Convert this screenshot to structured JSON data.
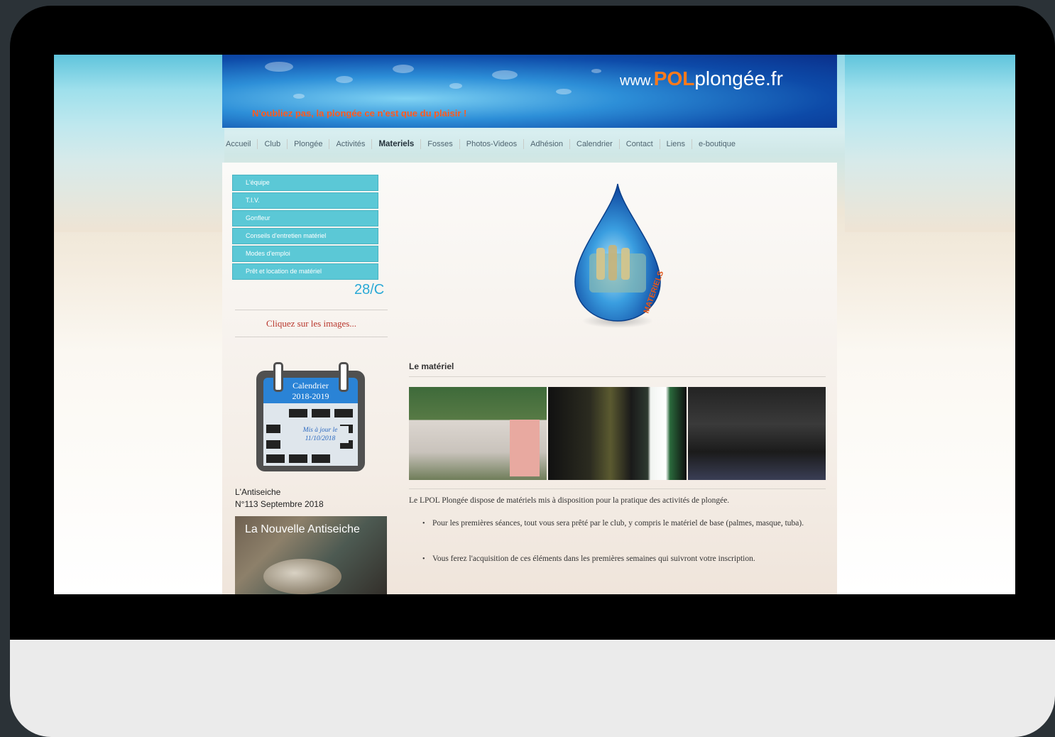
{
  "banner": {
    "slogan": "N'oubliez pas, la plongée ce n'est que du plaisir !",
    "site_www": "www.",
    "site_brand": "POL",
    "site_rest": "plongée.fr"
  },
  "nav": {
    "items": [
      "Accueil",
      "Club",
      "Plongée",
      "Activités",
      "Materiels",
      "Fosses",
      "Photos-Videos",
      "Adhésion",
      "Calendrier",
      "Contact",
      "Liens",
      "e-boutique"
    ],
    "active": "Materiels"
  },
  "sidebar": {
    "submenu": [
      "L'équipe",
      "T.I.V.",
      "Gonfleur",
      "Conseils d'entretien matériel",
      "Modes d'emploi",
      "Prêt et location de matériel"
    ],
    "ticker": "28/C",
    "click_hint": "Cliquez sur les images...",
    "calendar": {
      "title_line1": "Calendrier",
      "title_line2": "2018-2019",
      "note_line1": "Mis à jour le",
      "note_line2": "11/10/2018"
    },
    "antiseiche": {
      "title_line1": "L'Antiseiche",
      "title_line2": "N°113 Septembre 2018",
      "image_label": "La Nouvelle Antiseiche"
    }
  },
  "main": {
    "logo_label": "MATERIELS",
    "title": "Le matériel",
    "intro": "Le LPOL Plongée dispose de matériels mis à disposition pour la pratique des activités de plongée.",
    "bullets": [
      "Pour les premières séances, tout vous sera prêté par le club, y compris le matériel de base (palmes, masque, tuba).",
      "Vous ferez l'acquisition de ces éléments dans les premières semaines qui suivront votre inscription."
    ]
  },
  "colors": {
    "submenu_bg": "#5bc8d6",
    "slogan": "#ff5a1e",
    "ticker": "#2aa9d6"
  }
}
